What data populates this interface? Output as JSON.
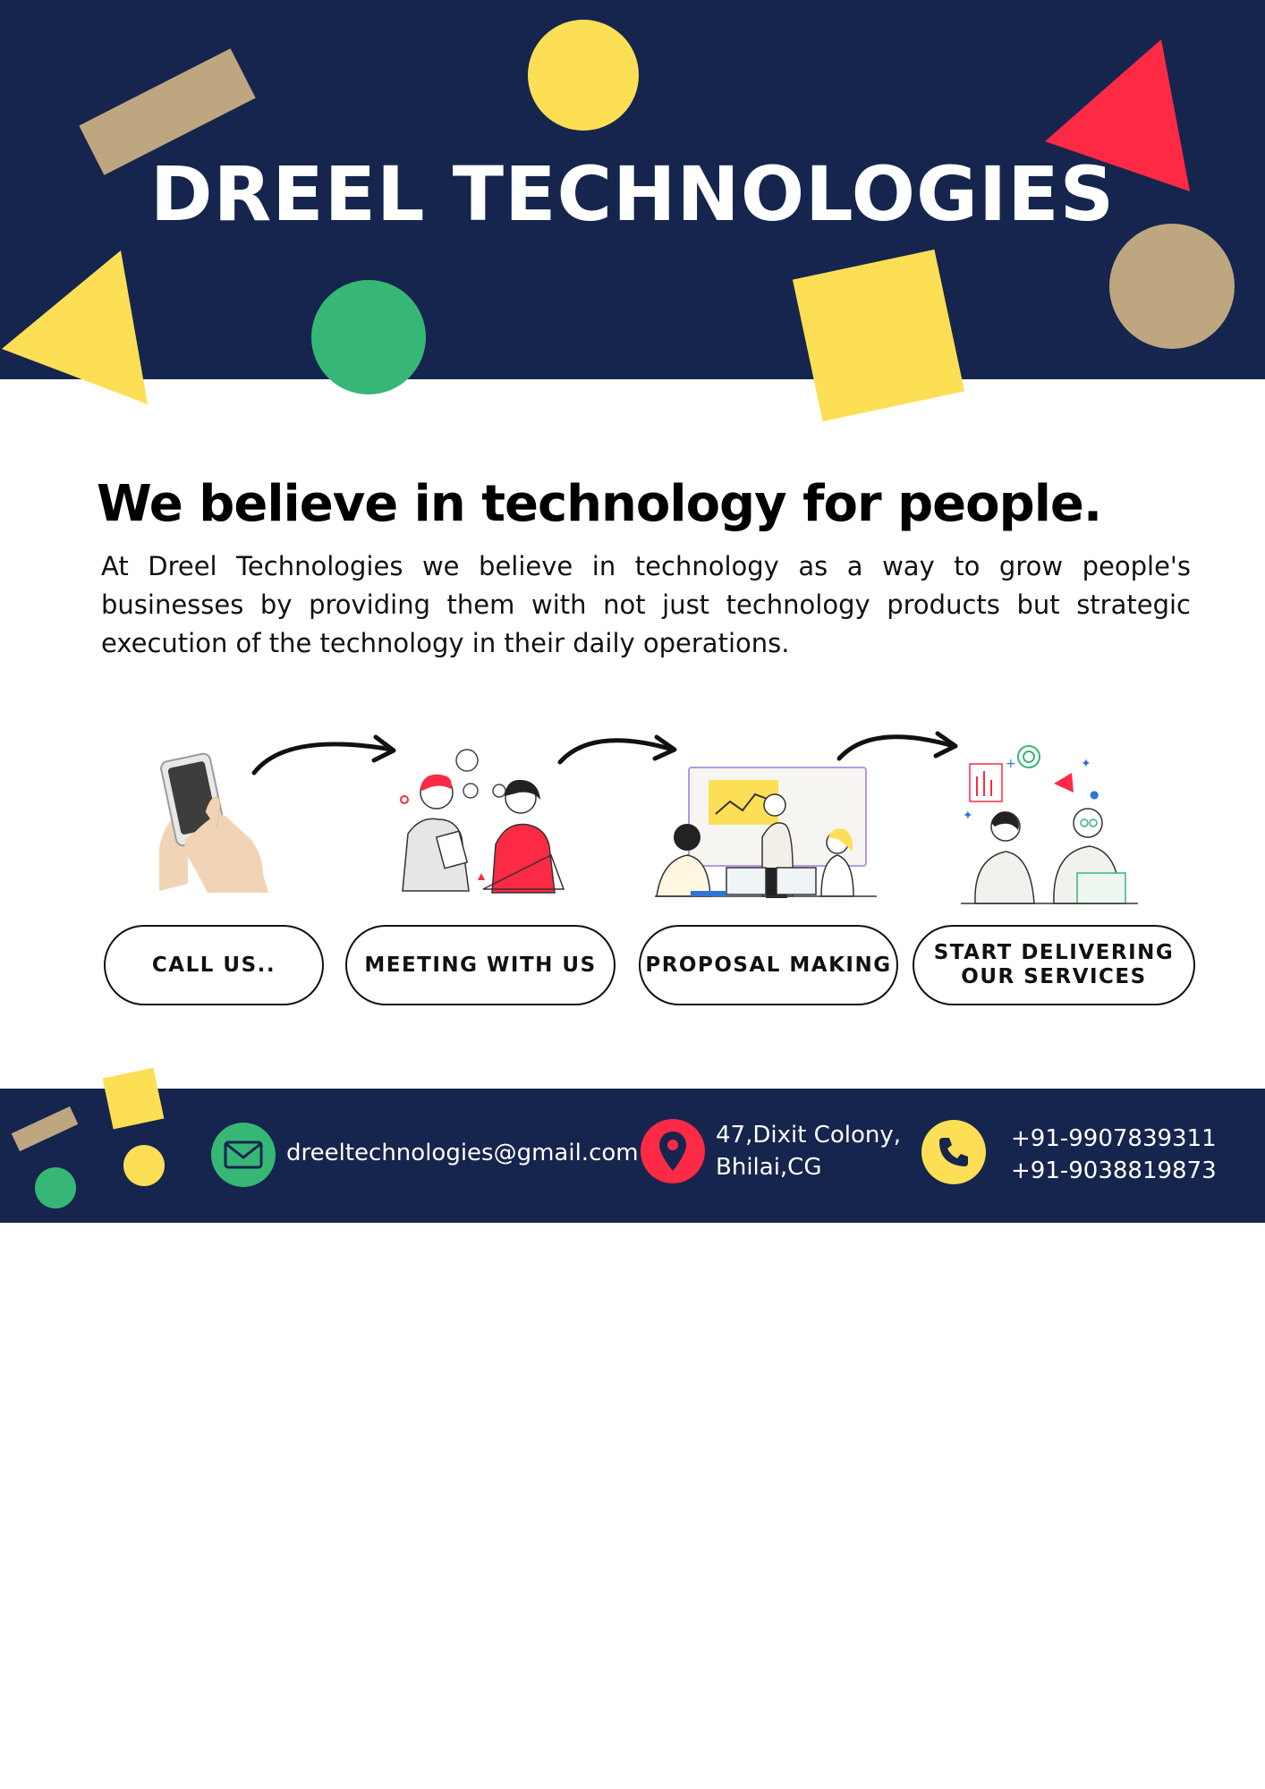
{
  "header": {
    "title": "DREEL TECHNOLOGIES"
  },
  "intro": {
    "headline": "We believe in technology for people.",
    "body": "At Dreel Technologies we believe in technology as a way to grow people's businesses by providing them with not just technology products but strategic execution of the technology in their daily operations."
  },
  "steps": [
    {
      "label": "CALL US..",
      "illustration": "phone-hand-illustration"
    },
    {
      "label": "MEETING WITH US",
      "illustration": "meeting-illustration"
    },
    {
      "label": "PROPOSAL MAKING",
      "illustration": "presentation-illustration"
    },
    {
      "label": "START DELIVERING\nOUR SERVICES",
      "illustration": "delivery-illustration"
    }
  ],
  "footer": {
    "email": "dreeltechnologies@gmail.com",
    "address_line1": "47,Dixit Colony,",
    "address_line2": "Bhilai,CG",
    "phone1": "+91-9907839311",
    "phone2": "+91-9038819873",
    "icons": [
      "mail-icon",
      "location-pin-icon",
      "phone-icon"
    ]
  },
  "colors": {
    "navy": "#16254d",
    "yellow": "#fddf55",
    "red": "#fc2a45",
    "green": "#37b776",
    "tan": "#bea681"
  }
}
